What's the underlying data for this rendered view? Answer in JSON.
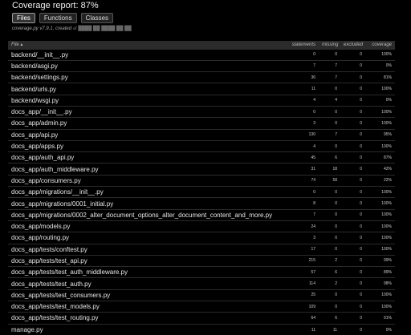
{
  "header": {
    "title": "Coverage report: 87%",
    "buttons": [
      "Files",
      "Functions",
      "Classes"
    ],
    "subtitle_prefix": "coverage.py v7.9.1, created ",
    "subtitle_blurred": "at ████ ██ ████ ██:██"
  },
  "table": {
    "columns": [
      "File",
      "statements",
      "missing",
      "excluded",
      "coverage"
    ],
    "sort_indicator": "▴",
    "rows": [
      [
        "backend/__init__.py",
        "0",
        "0",
        "0",
        "100%"
      ],
      [
        "backend/asgi.py",
        "7",
        "7",
        "0",
        "0%"
      ],
      [
        "backend/settings.py",
        "36",
        "7",
        "0",
        "81%"
      ],
      [
        "backend/urls.py",
        "11",
        "0",
        "0",
        "100%"
      ],
      [
        "backend/wsgi.py",
        "4",
        "4",
        "0",
        "0%"
      ],
      [
        "docs_app/__init__.py",
        "0",
        "0",
        "0",
        "100%"
      ],
      [
        "docs_app/admin.py",
        "3",
        "0",
        "0",
        "100%"
      ],
      [
        "docs_app/api.py",
        "130",
        "7",
        "0",
        "95%"
      ],
      [
        "docs_app/apps.py",
        "4",
        "0",
        "0",
        "100%"
      ],
      [
        "docs_app/auth_api.py",
        "45",
        "6",
        "0",
        "87%"
      ],
      [
        "docs_app/auth_middleware.py",
        "31",
        "18",
        "0",
        "42%"
      ],
      [
        "docs_app/consumers.py",
        "74",
        "58",
        "0",
        "22%"
      ],
      [
        "docs_app/migrations/__init__.py",
        "0",
        "0",
        "0",
        "100%"
      ],
      [
        "docs_app/migrations/0001_initial.py",
        "8",
        "0",
        "0",
        "100%"
      ],
      [
        "docs_app/migrations/0002_alter_document_options_alter_document_content_and_more.py",
        "7",
        "0",
        "0",
        "100%"
      ],
      [
        "docs_app/models.py",
        "24",
        "0",
        "0",
        "100%"
      ],
      [
        "docs_app/routing.py",
        "3",
        "0",
        "0",
        "100%"
      ],
      [
        "docs_app/tests/conftest.py",
        "17",
        "0",
        "0",
        "100%"
      ],
      [
        "docs_app/tests/test_api.py",
        "215",
        "2",
        "0",
        "99%"
      ],
      [
        "docs_app/tests/test_auth_middleware.py",
        "57",
        "6",
        "0",
        "89%"
      ],
      [
        "docs_app/tests/test_auth.py",
        "114",
        "2",
        "0",
        "98%"
      ],
      [
        "docs_app/tests/test_consumers.py",
        "25",
        "0",
        "0",
        "100%"
      ],
      [
        "docs_app/tests/test_models.py",
        "109",
        "0",
        "0",
        "100%"
      ],
      [
        "docs_app/tests/test_routing.py",
        "64",
        "6",
        "0",
        "91%"
      ],
      [
        "manage.py",
        "11",
        "11",
        "0",
        "0%"
      ]
    ]
  }
}
